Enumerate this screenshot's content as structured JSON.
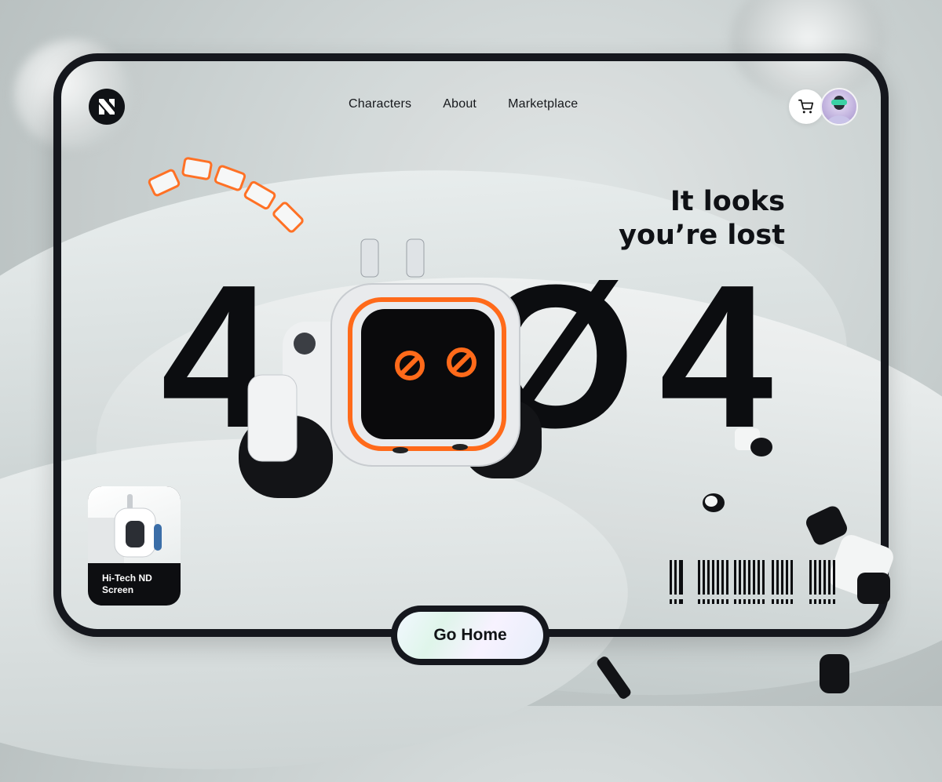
{
  "brand": {
    "logo_icon": "n-logo-icon"
  },
  "nav": {
    "items": [
      {
        "label": "Characters"
      },
      {
        "label": "About"
      },
      {
        "label": "Marketplace"
      }
    ]
  },
  "header_actions": {
    "cart_icon": "cart-icon",
    "avatar_icon": "user-avatar"
  },
  "hero": {
    "headline_line1": "It looks",
    "headline_line2": "you’re lost",
    "error_digits": [
      "4",
      "Ø",
      "4"
    ]
  },
  "product_card": {
    "title": "Hi-Tech ND Screen"
  },
  "cta": {
    "label": "Go Home"
  },
  "colors": {
    "accent": "#ff6a1a",
    "dark": "#15171d",
    "background": "#c9d0d0"
  }
}
